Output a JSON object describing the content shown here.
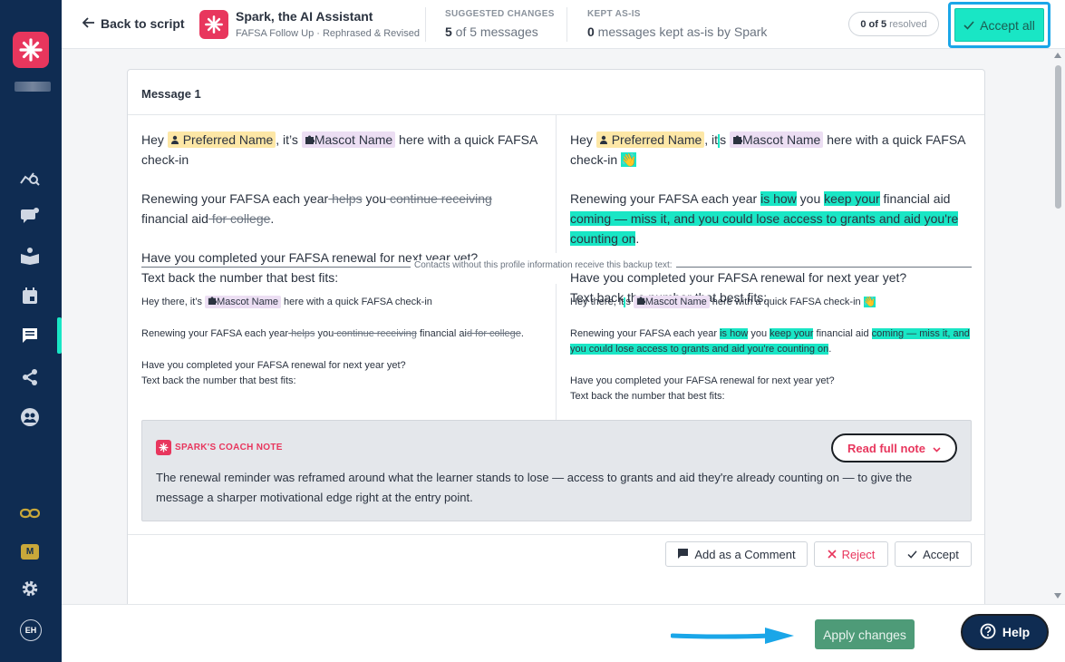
{
  "nav": {
    "badge_m": "M",
    "avatar": "EH",
    "icons": [
      "analytics-icon",
      "chat-bubbles-icon",
      "book-icon",
      "calendar-icon",
      "message-icon",
      "share-icon",
      "people-icon",
      "link-icon",
      "gear-icon"
    ]
  },
  "header": {
    "back_label": "Back to script",
    "title": "Spark, the AI Assistant",
    "subtitle": "FAFSA Follow Up · Rephrased & Revised",
    "suggested_label": "SUGGESTED CHANGES",
    "suggested_count": "5",
    "suggested_rest": " of 5 messages",
    "kept_label": "KEPT AS-IS",
    "kept_count": "0",
    "kept_rest": " messages kept as-is by Spark",
    "resolved_count": "0 of 5",
    "resolved_label": "resolved",
    "accept_all": "Accept all"
  },
  "message": {
    "title": "Message 1",
    "original": {
      "hey": "Hey",
      "preferred_name": "Preferred Name",
      "its": ", it’s",
      "mascot_name": "Mascot Name",
      "here": " here with a quick FAFSA check-in",
      "renew_a": "Renewing your FAFSA each year",
      "renew_del1": " helps",
      "renew_b": " you",
      "renew_del2": " continue receiving",
      "renew_c": " financial aid",
      "renew_del3": " for college",
      "renew_d": ".",
      "q1": "Have you completed your FAFSA renewal for next year yet?",
      "q2": "Text back the number that best fits:"
    },
    "revised": {
      "hey": "Hey",
      "preferred_name": "Preferred Name",
      "its_a": ", it",
      "its_b": "s",
      "mascot_name": "Mascot Name",
      "here": " here with a quick FAFSA check-in",
      "emoji": "👋",
      "renew_a": "Renewing your FAFSA each year ",
      "renew_add1": "is how",
      "renew_b": " you ",
      "renew_add2": "keep your",
      "renew_c": " financial aid ",
      "renew_add3": "coming — miss it, and you could lose access to grants and aid you're counting on",
      "renew_d": ".",
      "q1": "Have you completed your FAFSA renewal for next year yet?",
      "q2": "Text back the number that best fits:"
    },
    "backup_label": "Contacts without this profile information receive this backup text:",
    "backup_original": {
      "hey": "Hey there, it’s",
      "mascot_name": "Mascot Name",
      "here": " here with a quick FAFSA check-in",
      "renew_a": "Renewing your FAFSA each year",
      "renew_del1": " helps",
      "renew_b": " you",
      "renew_del2": " continue receiving",
      "renew_c": " financial ai",
      "renew_del3": "d for college",
      "renew_d": ".",
      "q1": "Have you completed your FAFSA renewal for next year yet?",
      "q2": "Text back the number that best fits:"
    },
    "backup_revised": {
      "hey_a": "Hey there, it",
      "hey_b": "s",
      "mascot_name": "Mascot Name",
      "here": " here with a quick FAFSA check-in",
      "emoji": "👋",
      "renew_a": "Renewing your FAFSA each year ",
      "renew_add1": "is how",
      "renew_b": " you ",
      "renew_add2": "keep your",
      "renew_c": " financial aid ",
      "renew_add3": "coming — miss it, and you could lose access to grants and aid you're counting on",
      "renew_d": ".",
      "q1": "Have you completed your FAFSA renewal for next year yet?",
      "q2": "Text back the number that best fits:"
    },
    "coach": {
      "title": "SPARK'S COACH NOTE",
      "read_full": "Read full note",
      "text": "The renewal reminder was reframed around what the learner stands to lose — access to grants and aid they're already counting on — to give the message a sharper motivational edge right at the entry point."
    },
    "actions": {
      "comment": "Add as a Comment",
      "reject": "Reject",
      "accept": "Accept"
    }
  },
  "footer": {
    "apply": "Apply changes",
    "help": "Help"
  },
  "colors": {
    "nav_bg": "#0f2c52",
    "brand": "#e8365d",
    "accent": "#19e6c5",
    "apply_bg": "#4e9b78",
    "highlight_border": "#1aa6e8"
  }
}
